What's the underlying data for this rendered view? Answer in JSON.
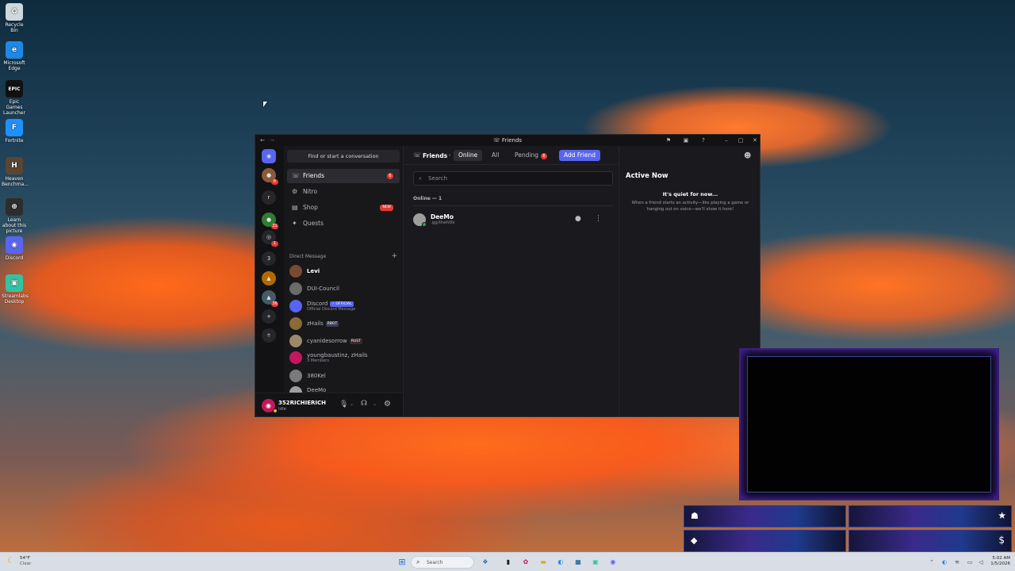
{
  "desktop": {
    "icons": [
      {
        "label": "Recycle Bin",
        "glyph": "♻",
        "color": "#cfd8dc"
      },
      {
        "label": "Microsoft Edge",
        "glyph": "e",
        "color": "#1e88e5"
      },
      {
        "label": "Epic Games Launcher",
        "glyph": "EPIC",
        "color": "#111111"
      },
      {
        "label": "Fortnite",
        "glyph": "F",
        "color": "#1e90ff"
      },
      {
        "label": "Heaven Benchma...",
        "glyph": "H",
        "color": "#5a4632"
      },
      {
        "label": "Learn about this picture",
        "glyph": "⊕",
        "color": "#2d2d2d"
      },
      {
        "label": "Discord",
        "glyph": "◉",
        "color": "#5865f2"
      },
      {
        "label": "Streamlabs Desktop",
        "glyph": "▣",
        "color": "#31c3a2"
      }
    ]
  },
  "window": {
    "title": "Friends"
  },
  "rail": {
    "items": [
      {
        "glyph": "◉",
        "badge": "",
        "color": "#5865f2"
      },
      {
        "glyph": "●",
        "badge": "6",
        "color": "#8a5a3c"
      },
      {
        "glyph": "r",
        "badge": "",
        "color": "#25252a"
      },
      {
        "glyph": "●",
        "badge": "31",
        "color": "#2e7d32"
      },
      {
        "glyph": "◎",
        "badge": "1",
        "color": "#25252a"
      },
      {
        "glyph": "3",
        "badge": "",
        "color": "#25252a"
      },
      {
        "glyph": "▲",
        "badge": "",
        "color": "#b26a00"
      },
      {
        "glyph": "▲",
        "badge": "36",
        "color": "#455a64"
      },
      {
        "glyph": "+",
        "badge": "",
        "color": "#25252a"
      },
      {
        "glyph": "⌾",
        "badge": "",
        "color": "#25252a"
      }
    ]
  },
  "dm": {
    "find_label": "Find or start a conversation",
    "nav": [
      {
        "label": "Friends",
        "icon": "☏",
        "badge": "6"
      },
      {
        "label": "Nitro",
        "icon": "⚙",
        "badge": ""
      },
      {
        "label": "Shop",
        "icon": "▤",
        "badge": "NEW"
      },
      {
        "label": "Quests",
        "icon": "✦",
        "badge": ""
      }
    ],
    "header": "Direct Message",
    "list": [
      {
        "name": "Levi",
        "sub": "",
        "tag": "",
        "tagColor": "",
        "avatar": "#7a4a32",
        "bright": true
      },
      {
        "name": "DUI-Council",
        "sub": "",
        "tag": "",
        "tagColor": "",
        "avatar": "#6b6b6b",
        "bright": false
      },
      {
        "name": "Discord",
        "sub": "Official Discord Message",
        "tag": "✓ OFFICIAL",
        "tagColor": "#5865f2",
        "avatar": "#5865f2",
        "bright": false
      },
      {
        "name": "zHails",
        "sub": "",
        "tag": "RBOT",
        "tagColor": "#3a3f55",
        "avatar": "#8a6a3a",
        "bright": false
      },
      {
        "name": "cyanidesorrow",
        "sub": "",
        "tag": "RUST",
        "tagColor": "#3a2a2a",
        "avatar": "#9a8a6a",
        "bright": false
      },
      {
        "name": "youngbaustinz, zHails",
        "sub": "3 Members",
        "tag": "",
        "tagColor": "",
        "avatar": "#c2185b",
        "bright": false
      },
      {
        "name": "380Kel",
        "sub": "",
        "tag": "",
        "tagColor": "",
        "avatar": "#7a7a7a",
        "bright": false
      },
      {
        "name": "DeeMo",
        "sub": ".gg/thehills",
        "tag": "",
        "tagColor": "",
        "avatar": "#9e9e9e",
        "bright": false
      }
    ]
  },
  "user": {
    "name": "352RICHIERICH",
    "status": "Idle"
  },
  "friends": {
    "title": "Friends",
    "tabs": [
      "Online",
      "All",
      "Pending"
    ],
    "pending_badge": "6",
    "add_friend": "Add Friend",
    "search_placeholder": "Search",
    "online_header": "Online — 1",
    "rows": [
      {
        "name": "DeeMo",
        "sub": ".gg/thehills"
      }
    ]
  },
  "active_now": {
    "title": "Active Now",
    "quiet": "It's quiet for now...",
    "desc": "When a friend starts an activity—like playing a game or hanging out on voice—we'll show it here!"
  },
  "taskbar": {
    "weather_temp": "54°F",
    "weather_desc": "Clear",
    "search": "Search",
    "time": "5:02 AM",
    "date": "1/5/2026"
  }
}
